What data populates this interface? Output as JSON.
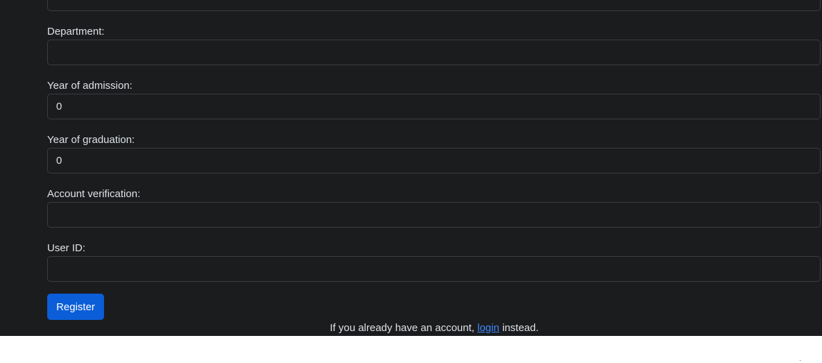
{
  "form": {
    "fields": [
      {
        "label": "Department:",
        "value": ""
      },
      {
        "label": "Year of admission:",
        "value": "0"
      },
      {
        "label": "Year of graduation:",
        "value": "0"
      },
      {
        "label": "Account verification:",
        "value": ""
      },
      {
        "label": "User ID:",
        "value": ""
      }
    ],
    "top_field": {
      "value": ""
    },
    "submit_label": "Register"
  },
  "footer": {
    "prefix": "If you already have an account, ",
    "login_link": "login",
    "suffix": " instead."
  },
  "colors": {
    "background": "#1b1c1e",
    "input_border": "#3a3d42",
    "text": "#dee2e6",
    "primary_button": "#0b5ed7",
    "link": "#3d8bfd"
  }
}
